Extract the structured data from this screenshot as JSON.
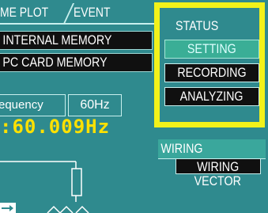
{
  "tabs": {
    "plot_label": "ME PLOT",
    "event_label": "EVENT"
  },
  "memory": {
    "internal_label": "INTERNAL MEMORY",
    "pc_card_label": "PC CARD  MEMORY"
  },
  "frequency": {
    "label": "equency",
    "setting_value": "60Hz",
    "reading": ":60.009Hz"
  },
  "status_panel": {
    "title": "STATUS",
    "items": [
      {
        "label": "SETTING",
        "selected": true
      },
      {
        "label": "RECORDING",
        "selected": false
      },
      {
        "label": "ANALYZING",
        "selected": false
      }
    ],
    "highlight_color": "#f2f21a"
  },
  "wiring_menu": {
    "tab_label": "WIRING",
    "items": [
      {
        "label": "WIRING",
        "selected": true
      },
      {
        "label": "VECTOR",
        "selected": false
      }
    ]
  },
  "colors": {
    "background": "#2f8a8e",
    "reading_text": "#ffe100",
    "selected_button": "#3aae96"
  }
}
